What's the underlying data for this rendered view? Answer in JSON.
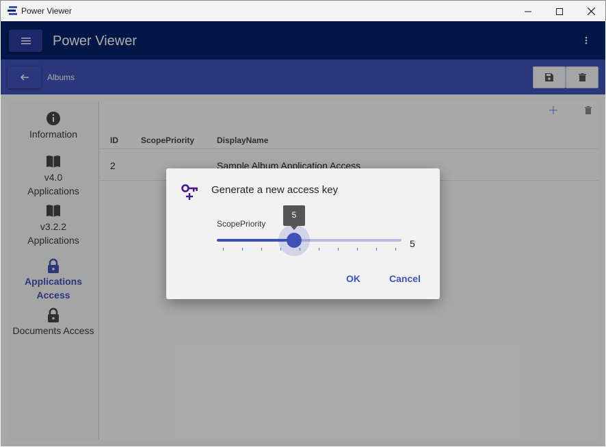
{
  "window": {
    "title": "Power Viewer",
    "controls": [
      "minimize-icon",
      "maximize-icon",
      "close-icon"
    ]
  },
  "appbar": {
    "title": "Power Viewer"
  },
  "subbar": {
    "breadcrumb": "Albums"
  },
  "sidebar": {
    "items": [
      {
        "label": "Information",
        "icon": "info-icon",
        "active": false
      },
      {
        "label_line1": "v4.0",
        "label_line2": "Applications",
        "icon": "book-icon",
        "active": false
      },
      {
        "label_line1": "v3.2.2",
        "label_line2": "Applications",
        "icon": "book-icon",
        "active": false
      },
      {
        "label": "Applications Access",
        "icon": "lock-icon",
        "active": true
      },
      {
        "label": "Documents Access",
        "icon": "lock-icon",
        "active": false
      }
    ]
  },
  "grid": {
    "columns": [
      "ID",
      "ScopePriority",
      "DisplayName"
    ],
    "rows": [
      {
        "id": "2",
        "scope_priority": "",
        "display_name": "Sample Album Application Access"
      }
    ]
  },
  "dialog": {
    "title": "Generate a new access key",
    "field_label": "ScopePriority",
    "slider": {
      "value": "5",
      "min": 1,
      "max": 10,
      "current": 5
    },
    "ok_label": "OK",
    "cancel_label": "Cancel"
  },
  "colors": {
    "primary": "#3f51b5",
    "header": "#032169",
    "key_icon": "#4a148c"
  }
}
